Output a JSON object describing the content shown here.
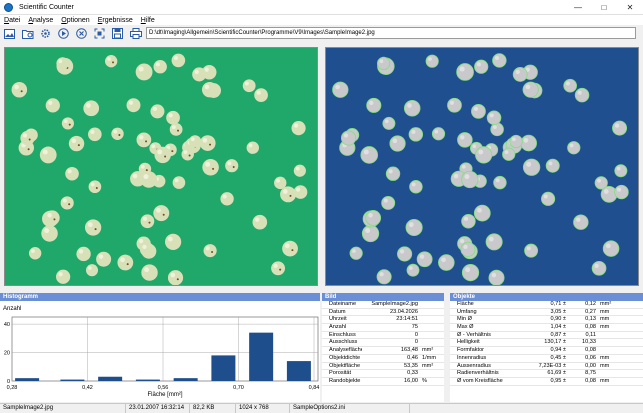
{
  "window": {
    "title": "Scientific Counter"
  },
  "menu": [
    {
      "label": "Datei",
      "u": "D"
    },
    {
      "label": "Analyse",
      "u": "A"
    },
    {
      "label": "Optionen",
      "u": "O"
    },
    {
      "label": "Ergebnisse",
      "u": "E"
    },
    {
      "label": "Hilfe",
      "u": "H"
    }
  ],
  "toolbar": {
    "icons": [
      "open-image-icon",
      "open-folder-icon",
      "settings-icon",
      "play-icon",
      "stop-icon",
      "fit-icon",
      "save-icon",
      "print-icon"
    ],
    "path": "D:\\dt\\Imaging\\Allgemein\\ScientificCounter\\Programme\\V9\\Images\\SampleImage2.jpg"
  },
  "sections": {
    "histogram": "Histogramm",
    "bild": "Bild",
    "objekte": "Objekte"
  },
  "histogram": {
    "ylabel": "Anzahl",
    "xlabel": "Fläche [mm²]"
  },
  "chart_data": {
    "type": "bar",
    "title": "Histogramm",
    "xlabel": "Fläche [mm²]",
    "ylabel": "Anzahl",
    "x_ticks": [
      "0,28",
      "0,42",
      "0,56",
      "0,70",
      "0,84"
    ],
    "y_ticks": [
      "0",
      "20",
      "40"
    ],
    "ylim": [
      0,
      45
    ],
    "xlim": [
      0.28,
      0.84
    ],
    "bin_centers": [
      0.308,
      0.364,
      0.42,
      0.476,
      0.532,
      0.588,
      0.644,
      0.7,
      0.756,
      0.812
    ],
    "values": [
      2,
      1,
      3,
      1,
      2,
      18,
      34,
      14
    ],
    "bars": [
      {
        "x": 0.308,
        "v": 2
      },
      {
        "x": 0.392,
        "v": 1
      },
      {
        "x": 0.462,
        "v": 3
      },
      {
        "x": 0.532,
        "v": 1
      },
      {
        "x": 0.602,
        "v": 2
      },
      {
        "x": 0.672,
        "v": 18
      },
      {
        "x": 0.742,
        "v": 34
      },
      {
        "x": 0.812,
        "v": 14
      }
    ],
    "grid": true
  },
  "bild": [
    {
      "k": "Dateiname",
      "v": "SampleImage2.jpg",
      "u": ""
    },
    {
      "k": "Datum",
      "v": "23.04.2026",
      "u": ""
    },
    {
      "k": "Uhrzeit",
      "v": "23:14:51",
      "u": ""
    },
    {
      "k": "Anzahl",
      "v": "75",
      "u": ""
    },
    {
      "k": "Einschluss",
      "v": "0",
      "u": ""
    },
    {
      "k": "Ausschluss",
      "v": "0",
      "u": ""
    },
    {
      "k": "Analysefläche",
      "v": "163,48",
      "u": "mm²"
    },
    {
      "k": "Objektdichte",
      "v": "0,46",
      "u": "1/mm"
    },
    {
      "k": "Objektfläche",
      "v": "53,35",
      "u": "mm²"
    },
    {
      "k": "Porosität",
      "v": "0,33",
      "u": ""
    },
    {
      "k": "Randobjekte",
      "v": "16,00",
      "u": "%"
    }
  ],
  "objekte": [
    {
      "k": "Fläche",
      "a": "0,71 ±",
      "b": "0,12",
      "u": "mm²"
    },
    {
      "k": "Umfang",
      "a": "3,05 ±",
      "b": "0,27",
      "u": "mm"
    },
    {
      "k": "Min Ø",
      "a": "0,90 ±",
      "b": "0,13",
      "u": "mm"
    },
    {
      "k": "Max Ø",
      "a": "1,04 ±",
      "b": "0,08",
      "u": "mm"
    },
    {
      "k": "Ø - Verhältnis",
      "a": "0,87 ±",
      "b": "0,11",
      "u": ""
    },
    {
      "k": "Helligkeit",
      "a": "130,17 ±",
      "b": "10,33",
      "u": ""
    },
    {
      "k": "Formfaktor",
      "a": "0,94 ±",
      "b": "0,08",
      "u": ""
    },
    {
      "k": "Innenradius",
      "a": "0,45 ±",
      "b": "0,06",
      "u": "mm"
    },
    {
      "k": "Aussenradius",
      "a": "7,23E-03 ±",
      "b": "0,00",
      "u": "mm"
    },
    {
      "k": "Radienverhältnis",
      "a": "61,69 ±",
      "b": "8,75",
      "u": ""
    },
    {
      "k": "Ø vom Kreisfläche",
      "a": "0,95 ±",
      "b": "0,08",
      "u": "mm"
    }
  ],
  "status": [
    "SampleImage2.jpg",
    "23.01.2007 16:32:14",
    "82,2 KB",
    "1024 x 768",
    "SampleOptions2.ini"
  ],
  "colors": {
    "green_bg": "#1fa86a",
    "blue_bg": "#1f4f8f",
    "header": "#6b8fd6",
    "bar": "#1f4e8c",
    "grape": "#d8e0b8",
    "outline": "#7ee07a"
  }
}
